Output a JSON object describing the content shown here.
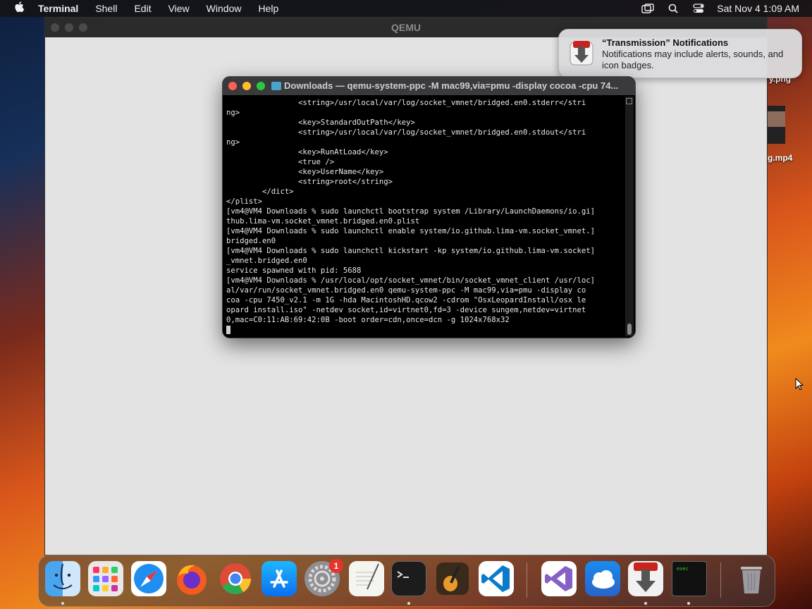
{
  "menubar": {
    "app_name": "Terminal",
    "items": [
      "Shell",
      "Edit",
      "View",
      "Window",
      "Help"
    ],
    "datetime": "Sat Nov 4  1:09 AM"
  },
  "qemu_window": {
    "title": "QEMU"
  },
  "desktop": {
    "file1_label": "y.png",
    "file2_label": "g.mp4"
  },
  "notification": {
    "title": "“Transmission” Notifications",
    "body": "Notifications may include alerts, sounds, and icon badges."
  },
  "terminal": {
    "title": "Downloads — qemu-system-ppc -M mac99,via=pmu -display cocoa -cpu 74...",
    "lines": [
      "                <string>/usr/local/var/log/socket_vmnet/bridged.en0.stderr</stri",
      "ng>",
      "                <key>StandardOutPath</key>",
      "                <string>/usr/local/var/log/socket_vmnet/bridged.en0.stdout</stri",
      "ng>",
      "                <key>RunAtLoad</key>",
      "                <true />",
      "                <key>UserName</key>",
      "                <string>root</string>",
      "        </dict>",
      "</plist>",
      "[vm4@VM4 Downloads % sudo launchctl bootstrap system /Library/LaunchDaemons/io.gi]",
      "thub.lima-vm.socket_vmnet.bridged.en0.plist",
      "[vm4@VM4 Downloads % sudo launchctl enable system/io.github.lima-vm.socket_vmnet.]",
      "bridged.en0",
      "[vm4@VM4 Downloads % sudo launchctl kickstart -kp system/io.github.lima-vm.socket]",
      "_vmnet.bridged.en0",
      "service spawned with pid: 5688",
      "[vm4@VM4 Downloads % /usr/local/opt/socket_vmnet/bin/socket_vmnet_client /usr/loc]",
      "al/var/run/socket_vmnet.bridged.en0 qemu-system-ppc -M mac99,via=pmu -display co",
      "coa -cpu 7450_v2.1 -m 1G -hda MacintoshHD.qcow2 -cdrom \"OsxLeopardInstall/osx le",
      "opard install.iso\" -netdev socket,id=virtnet0,fd=3 -device sungem,netdev=virtnet",
      "0,mac=C0:11:AB:69:42:0B -boot order=cdn,once=dcn -g 1024x768x32"
    ]
  },
  "dock": {
    "apps": [
      "finder",
      "launchpad",
      "safari",
      "firefox",
      "chrome",
      "app-store",
      "system-settings",
      "textedit",
      "terminal",
      "garageband",
      "vscode",
      "visual-studio",
      "weather",
      "transmission",
      "exec",
      "trash"
    ],
    "settings_badge": "1"
  },
  "colors": {
    "terminal_bg": "#000000",
    "notification_bg": "#dcdcde",
    "badge_red": "#e5352b"
  }
}
